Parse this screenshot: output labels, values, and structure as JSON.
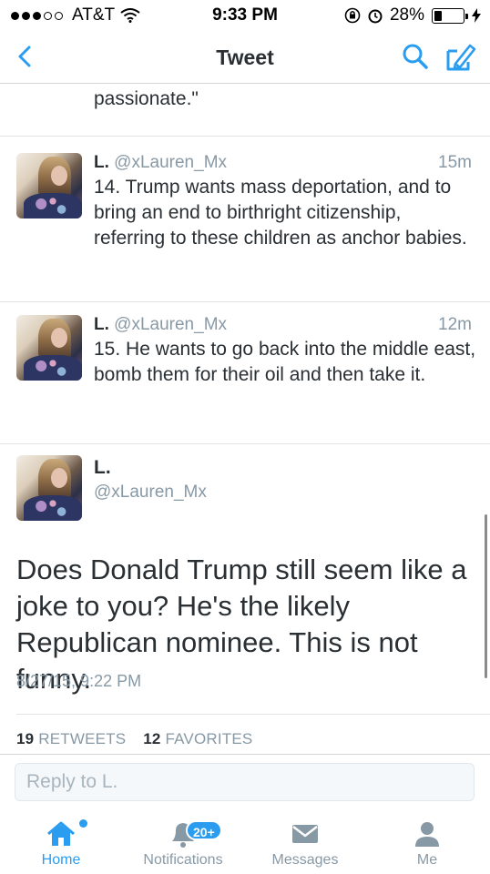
{
  "status_bar": {
    "carrier": "AT&T",
    "time": "9:33 PM",
    "battery": "28%",
    "battery_level": 0.28
  },
  "nav": {
    "title": "Tweet",
    "icons": [
      "back-chevron-icon",
      "search-icon",
      "compose-icon"
    ]
  },
  "timeline": {
    "previous_tail": "passionate.\"",
    "tweets": [
      {
        "name": "L.",
        "handle": "@xLauren_Mx",
        "time": "15m",
        "text": "14. Trump wants mass deportation, and to bring an end to birthright citizenship, referring to these children as anchor babies."
      },
      {
        "name": "L.",
        "handle": "@xLauren_Mx",
        "time": "12m",
        "text": "15. He wants to go back into the middle east, bomb them for their oil and then take it."
      }
    ],
    "detail": {
      "name": "L.",
      "handle": "@xLauren_Mx",
      "text": "Does Donald Trump still seem like a joke to you? He's the likely Republican nominee. This is not funny.",
      "date": "8/27/15, 9:22 PM",
      "retweets_count": "19",
      "retweets_label": "RETWEETS",
      "favorites_count": "12",
      "favorites_label": "FAVORITES"
    }
  },
  "reply": {
    "placeholder": "Reply to L."
  },
  "tabs": {
    "home": "Home",
    "notifications": "Notifications",
    "notifications_badge": "20+",
    "messages": "Messages",
    "me": "Me"
  },
  "colors": {
    "accent": "#2b9df0",
    "text": "#292f33",
    "muted": "#8899a6"
  }
}
